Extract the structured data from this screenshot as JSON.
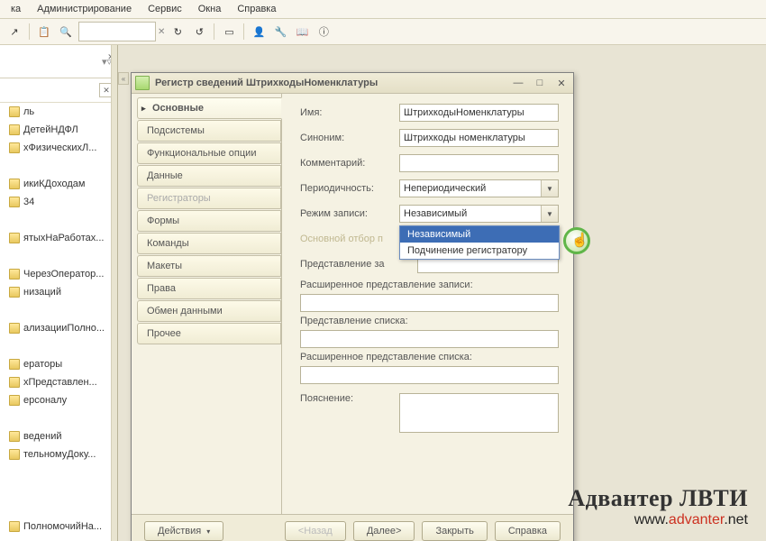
{
  "menu": {
    "items": [
      "ка",
      "Администрирование",
      "Сервис",
      "Окна",
      "Справка"
    ],
    "accel": [
      0,
      0,
      0,
      0,
      0
    ]
  },
  "dialog": {
    "title": "Регистр сведений ШтрихкодыНоменклатуры",
    "tabs": [
      "Основные",
      "Подсистемы",
      "Функциональные опции",
      "Данные",
      "Регистраторы",
      "Формы",
      "Команды",
      "Макеты",
      "Права",
      "Обмен данными",
      "Прочее"
    ],
    "active_tab": 0,
    "disabled_tabs": [
      4
    ],
    "fields": {
      "name_label": "Имя:",
      "name_value": "ШтрихкодыНоменклатуры",
      "synonym_label": "Синоним:",
      "synonym_value": "Штрихкоды номенклатуры",
      "comment_label": "Комментарий:",
      "comment_value": "",
      "periodicity_label": "Периодичность:",
      "periodicity_value": "Непериодический",
      "writemode_label": "Режим записи:",
      "writemode_value": "Независимый",
      "mainfilter_label": "Основной отбор п",
      "record_presentation_label": "Представление за",
      "record_presentation_value": "",
      "ext_record_label": "Расширенное представление записи:",
      "list_presentation_label": "Представление списка:",
      "ext_list_label": "Расширенное представление списка:",
      "explanation_label": "Пояснение:"
    },
    "dropdown": {
      "items": [
        "Независимый",
        "Подчинение регистратору"
      ],
      "selected": 0
    },
    "buttons": {
      "actions": "Действия",
      "back": "<Назад",
      "next": "Далее>",
      "close": "Закрыть",
      "help": "Справка"
    }
  },
  "left_list": [
    "ль",
    "ДетейНДФЛ",
    "хФизическихЛ...",
    "",
    "икиКДоходам",
    "34",
    "",
    "ятыхНаРаботах...",
    "",
    "ЧерезОператор...",
    "низаций",
    "",
    "ализацииПолно...",
    "",
    "ераторы",
    "хПредставлен...",
    "ерсоналу",
    "",
    "ведений",
    "тельномуДоку...",
    "",
    "",
    "",
    "ПолномочийНа..."
  ],
  "watermark": {
    "title": "Адвантер ЛВТИ",
    "url_pre": "www.",
    "url_mid": "advanter",
    "url_post": ".net"
  }
}
